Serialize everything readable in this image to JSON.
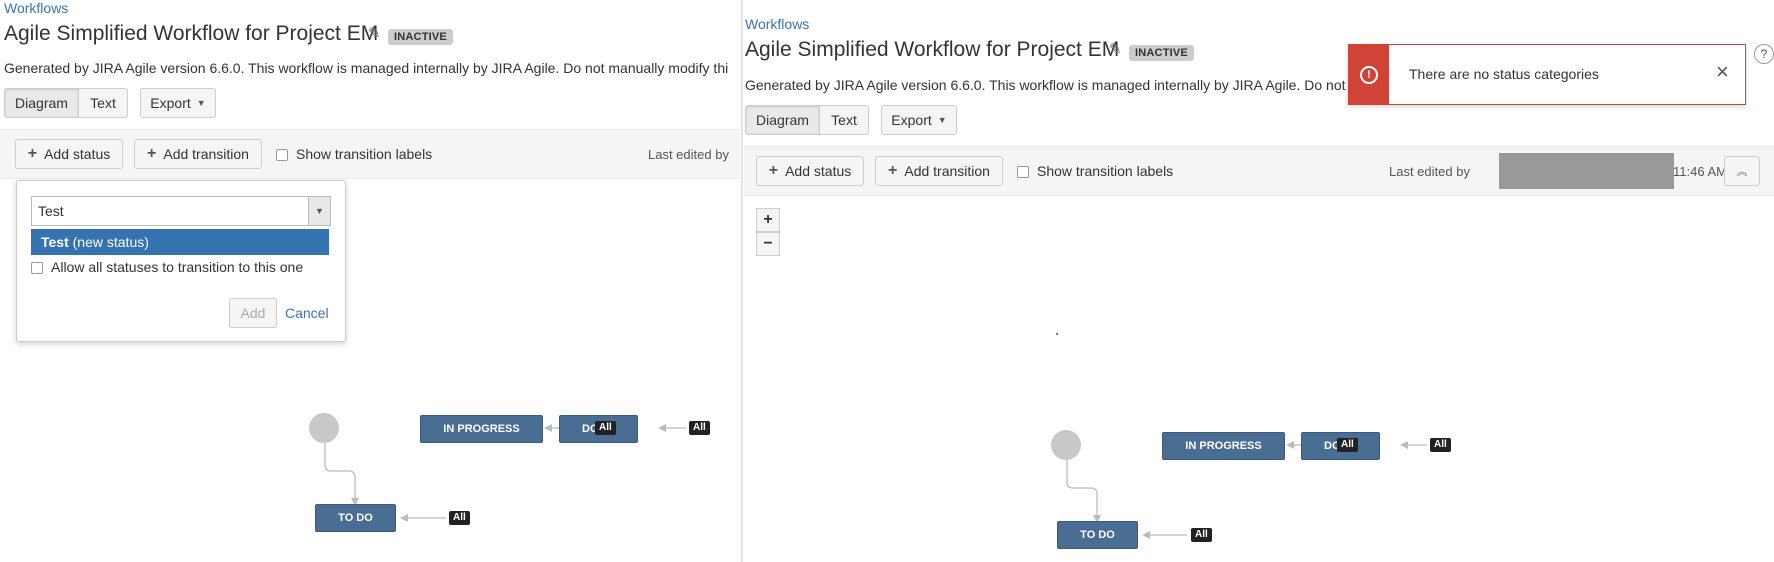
{
  "left_panel": {
    "breadcrumb": "Workflows",
    "title": "Agile Simplified Workflow for Project EM",
    "status_lozenge": "INACTIVE",
    "description": "Generated by JIRA Agile version 6.6.0. This workflow is managed internally by JIRA Agile. Do not manually modify thi",
    "view_tabs": {
      "diagram": "Diagram",
      "text": "Text"
    },
    "export_label": "Export",
    "toolbar": {
      "add_status": "Add status",
      "add_transition": "Add transition",
      "show_transition_labels": "Show transition labels",
      "last_edited": "Last edited by"
    },
    "add_status_dialog": {
      "input_value": "Test",
      "suggestion_bold": "Test",
      "suggestion_rest": " (new status)",
      "allow_all_label": "Allow all statuses to transition to this one",
      "add_button": "Add",
      "cancel_link": "Cancel"
    },
    "diagram": {
      "in_progress": "IN PROGRESS",
      "done_partial": "DO",
      "todo": "TO DO",
      "all_done_badge": "All",
      "all_done_arrow": "All",
      "all_todo": "All"
    }
  },
  "right_panel": {
    "breadcrumb": "Workflows",
    "title": "Agile Simplified Workflow for Project EM",
    "status_lozenge": "INACTIVE",
    "description": "Generated by JIRA Agile version 6.6.0. This workflow is managed internally by JIRA Agile. Do not",
    "view_tabs": {
      "diagram": "Diagram",
      "text": "Text"
    },
    "export_label": "Export",
    "toolbar": {
      "add_status": "Add status",
      "add_transition": "Add transition",
      "show_transition_labels": "Show transition labels",
      "last_edited_prefix": "Last edited by",
      "last_edited_time": "11:46 AM"
    },
    "zoom": {
      "in": "+",
      "out": "−"
    },
    "error_flag": {
      "message": "There are no status categories",
      "icon": "!",
      "close": "×"
    },
    "diagram": {
      "in_progress": "IN PROGRESS",
      "done_partial": "DO",
      "todo": "TO DO",
      "all_done_badge": "All",
      "all_done_arrow": "All",
      "all_todo": "All"
    }
  },
  "colors": {
    "link": "#3b73af",
    "status_node": "#4a6d93",
    "error": "#d04437",
    "selection": "#3572b0"
  }
}
